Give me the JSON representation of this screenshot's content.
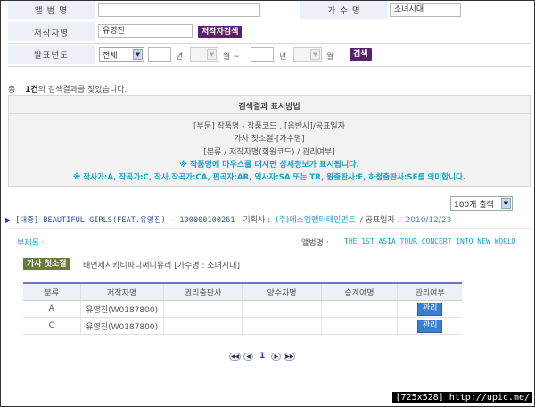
{
  "search_form": {
    "album_label": "앨 범 명",
    "album_value": "",
    "singer_label": "가 수 명",
    "singer_value": "소녀시대",
    "author_label": "저작자명",
    "author_value": "유영진",
    "author_search_button": "저작자검색",
    "year_label": "발표년도",
    "year_type_selected": "전체",
    "year_start": "",
    "year_unit_1": "년",
    "month_start": "",
    "month_unit_1": "월 ~",
    "year_end": "",
    "year_unit_2": "년",
    "month_end": "",
    "month_unit_2": "월",
    "search_button": "검색"
  },
  "result_summary": {
    "prefix": "총",
    "count": "1건",
    "suffix": "의 검색결과를 찾았습니다."
  },
  "guide": {
    "title": "검색결과 표시방법",
    "line1": "[부문] 작품명 - 작품코드 , [음반사]/공표일자",
    "line2": "가사 첫소절-[가수명]",
    "line3": "[분류 / 저작자명(회원코드) / 관리여부]",
    "line4": "※ 작품명에 마우스를 대시면 상세정보가 표시됩니다.",
    "line5": "※ 작사가:A, 작곡가:C, 작사.작곡가:CA, 편곡자:AR, 역사자:SA 또는 TR, 원출판사:E, 하청출판사:SE를 의미합니다."
  },
  "per_page": {
    "selected": "100개 출력"
  },
  "result": {
    "arrow": "▶",
    "title": "[대중] BEAUTIFUL GIRLS(FEAT.유영진) - 100000100261",
    "agency_label": "기획사 :",
    "agency_value": "(주)에스엠엔터테인먼트",
    "date_label": "/ 공표일자 :",
    "date_value": "2010/12/23",
    "subtitle_label": "부제목 :",
    "subtitle_value": "",
    "album_label": "앨범명 :",
    "album_value": "THE 1ST ASIA TOUR CONCERT INTO NEW WORLD",
    "lyric_badge": "가사 첫소절",
    "lyric_text": "태연제시카티파니써니유리 [가수명 : 소녀시대]"
  },
  "rights_table": {
    "headers": [
      "분류",
      "저작자명",
      "권리출판사",
      "양수자명",
      "승계여명",
      "관리여부"
    ],
    "rows": [
      {
        "type": "A",
        "author": "유영진(W0187800)",
        "publisher": "",
        "assignee": "",
        "successor": "",
        "manage": "관리"
      },
      {
        "type": "C",
        "author": "유영진(W0187800)",
        "publisher": "",
        "assignee": "",
        "successor": "",
        "manage": "관리"
      }
    ]
  },
  "pagination": {
    "first": "◀◀",
    "prev": "◀",
    "current": "1",
    "next": "▶",
    "last": "▶▶"
  },
  "watermark": "[725x528] http://upic.me/",
  "colors": {
    "label_bg": "#eef0f7",
    "purple_button": "#5a1f70",
    "accent_cyan": "#1a9ec6",
    "link_blue": "#2a3f9a",
    "manage_button": "#3a7fd6",
    "title_blue": "#3050a8"
  }
}
